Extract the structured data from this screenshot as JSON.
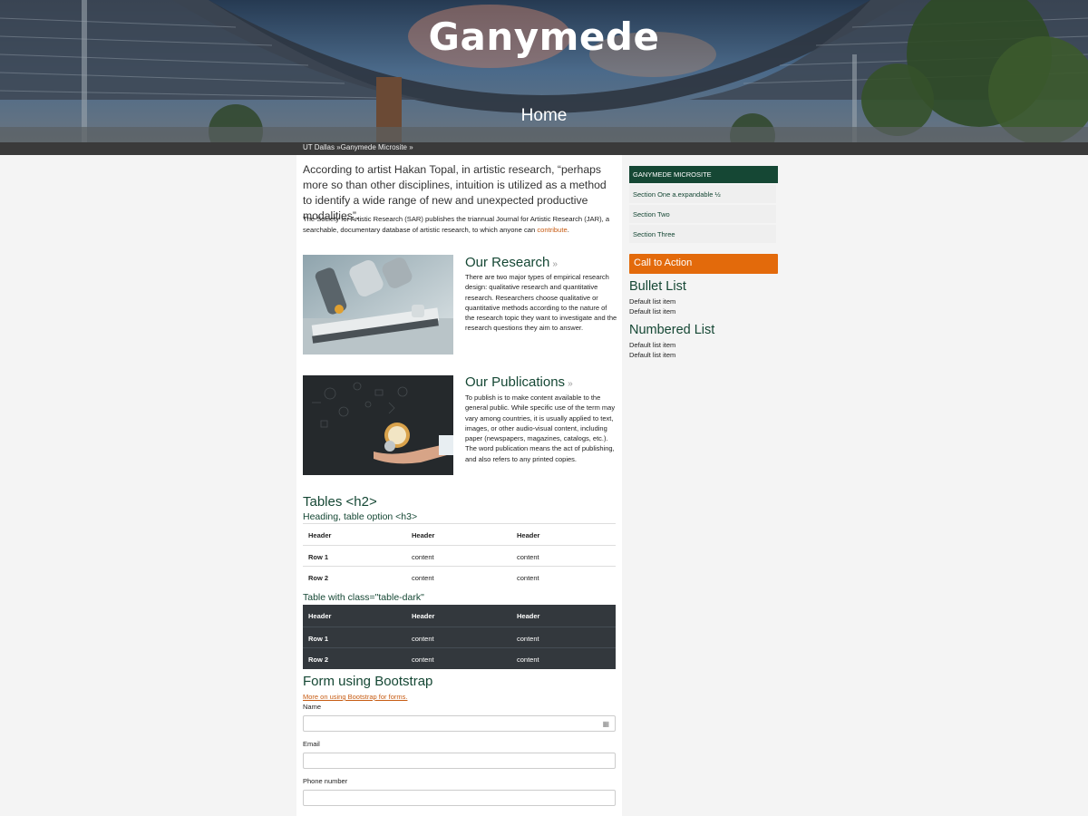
{
  "site": {
    "title": "Ganymede",
    "page_name": "Home"
  },
  "breadcrumb": "UT Dallas »Ganymede Microsite »",
  "intro": {
    "lead": "According to artist Hakan Topal, in artistic research, “perhaps more so than other disciplines, intuition is utilized as a method to identify a wide range of new and unexpected productive modalities”.",
    "para_before_link": "The Society for Artistic Research (SAR) publishes the triannual Journal for Artistic Research (JAR), a searchable, documentary database of artistic research, to which anyone can ",
    "link": "contribute",
    "para_after_link": "."
  },
  "features": [
    {
      "title": "Our Research",
      "arrow": "»",
      "text": "There are two major types of empirical research design: qualitative research and quantitative research. Researchers choose qualitative or quantitative methods according to the nature of the research topic they want to investigate and the research questions they aim to answer."
    },
    {
      "title": "Our Publications",
      "arrow": "»",
      "text": "To publish is to make content available to the general public. While specific use of the term may vary among countries, it is usually applied to text, images, or other audio-visual content, including paper (newspapers, magazines, catalogs, etc.). The word publication means the act of publishing, and also refers to any printed copies."
    }
  ],
  "tables": {
    "h2": "Tables <h2>",
    "h3": "Heading, table option <h3>",
    "headers": [
      "Header",
      "Header",
      "Header"
    ],
    "rows": [
      [
        "Row 1",
        "content",
        "content"
      ],
      [
        "Row 2",
        "content",
        "content"
      ]
    ],
    "dark_caption": "Table with class=\"table-dark\"",
    "dark_headers": [
      "Header",
      "Header",
      "Header"
    ],
    "dark_rows": [
      [
        "Row 1",
        "content",
        "content"
      ],
      [
        "Row 2",
        "content",
        "content"
      ]
    ]
  },
  "form": {
    "title": "Form using Bootstrap",
    "link": "More on using Bootstrap for forms.",
    "fields": [
      {
        "label": "Name",
        "value": ""
      },
      {
        "label": "Email",
        "value": ""
      },
      {
        "label": "Phone number",
        "value": ""
      }
    ]
  },
  "sidebar": {
    "heading": "GANYMEDE MICROSITE",
    "items": [
      {
        "label": "Section One a.expandable ½"
      },
      {
        "label": "Section Two"
      },
      {
        "label": "Section Three"
      }
    ],
    "cta": "Call to Action",
    "bullet_title": "Bullet List",
    "bullet_items": [
      "Default list item",
      "Default list item"
    ],
    "numbered_title": "Numbered List",
    "numbered_items": [
      "Default list item",
      "Default list item"
    ]
  },
  "colors": {
    "brand_green": "#154734",
    "accent_orange": "#e36a0b",
    "link_orange": "#c75b12",
    "dark_table": "#33383d"
  }
}
